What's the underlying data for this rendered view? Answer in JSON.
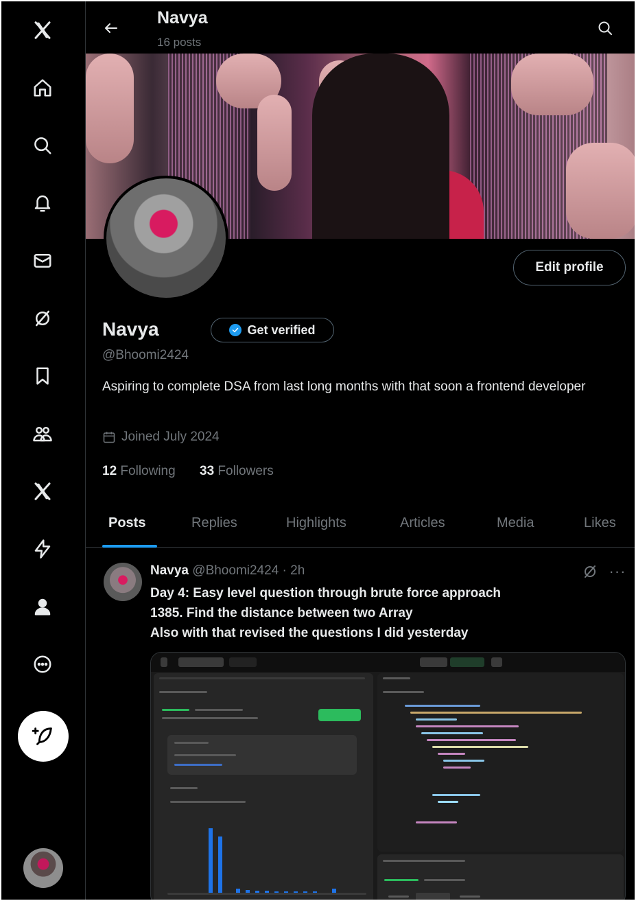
{
  "nav": {
    "items": [
      "x-logo",
      "home",
      "explore",
      "notifications",
      "messages",
      "grok",
      "bookmarks",
      "communities",
      "premium",
      "verified-orgs",
      "profile",
      "more"
    ]
  },
  "header": {
    "name": "Navya",
    "posts_count": "16 posts"
  },
  "profile": {
    "name": "Navya",
    "handle": "@Bhoomi2424",
    "get_verified_label": "Get verified",
    "edit_profile_label": "Edit profile",
    "bio": "Aspiring to complete DSA from last long months with that soon a frontend developer",
    "joined": "Joined July 2024",
    "following_count": "12",
    "following_label": "Following",
    "followers_count": "33",
    "followers_label": "Followers"
  },
  "tabs": [
    {
      "label": "Posts",
      "active": true
    },
    {
      "label": "Replies",
      "active": false
    },
    {
      "label": "Highlights",
      "active": false
    },
    {
      "label": "Articles",
      "active": false
    },
    {
      "label": "Media",
      "active": false
    },
    {
      "label": "Likes",
      "active": false
    }
  ],
  "post": {
    "author": "Navya",
    "handle_time": "@Bhoomi2424 · 2h",
    "lines": [
      "Day 4: Easy level question through brute force approach",
      "1385. Find the distance between two Array",
      "Also with that revised the questions I did yesterday"
    ]
  },
  "colors": {
    "accent": "#1d9bf0",
    "background": "#000000",
    "muted_text": "#71767b",
    "leetcode_green": "#2cbb5d",
    "leetcode_bar": "#1e73e8"
  }
}
